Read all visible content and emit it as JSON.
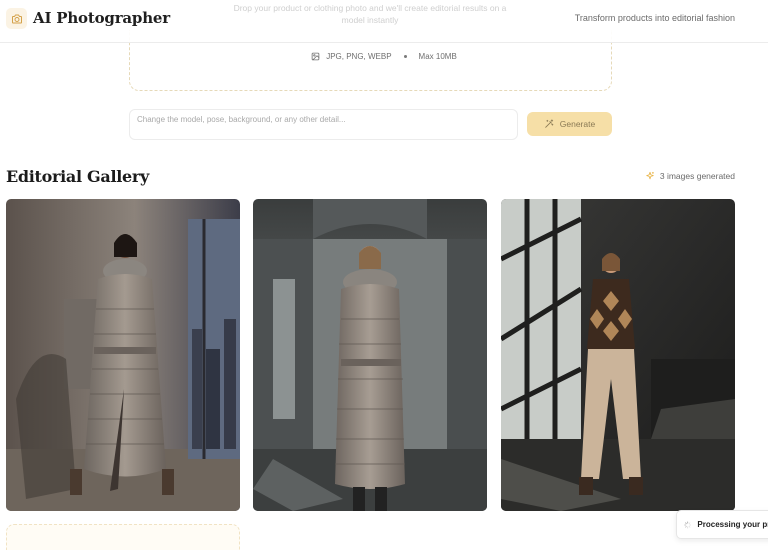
{
  "header": {
    "app_title": "AI Photographer",
    "tagline": "Transform products into editorial fashion",
    "faded_hint": "Drop your product or clothing photo and we'll create editorial results on a model instantly"
  },
  "upload": {
    "formats": "JPG, PNG, WEBP",
    "max_size": "Max 10MB"
  },
  "prompt": {
    "placeholder": "Change the model, pose, background, or any other detail...",
    "value": ""
  },
  "actions": {
    "generate_label": "Generate"
  },
  "gallery": {
    "title": "Editorial Gallery",
    "count_text": "3 images generated",
    "images": [
      {
        "description": "Model in grey belted puffer coat with fur collar by window"
      },
      {
        "description": "Model in grey long puffer coat in arched hall"
      },
      {
        "description": "Model in argyle sweater and beige trousers"
      }
    ]
  },
  "toast": {
    "text": "Processing your produ"
  },
  "colors": {
    "accent": "#f6dfa7",
    "accent_text": "#8a7a55",
    "accent_icon": "#e9b54a",
    "border": "#ececec"
  }
}
